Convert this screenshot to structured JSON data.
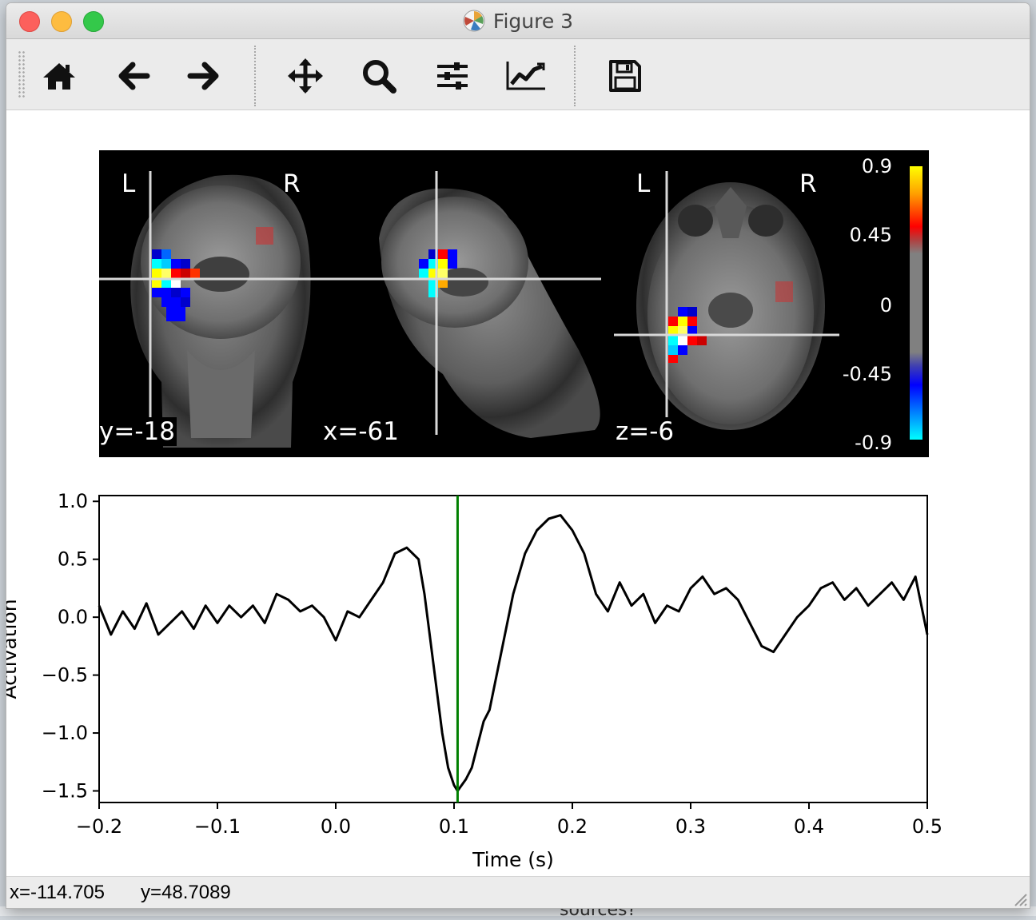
{
  "window": {
    "title": "Figure 3"
  },
  "toolbar": {
    "buttons": [
      {
        "name": "home",
        "icon": "home-icon"
      },
      {
        "name": "back",
        "icon": "arrow-left-icon"
      },
      {
        "name": "forward",
        "icon": "arrow-right-icon"
      },
      {
        "name": "pan",
        "icon": "move-icon"
      },
      {
        "name": "zoom",
        "icon": "magnifier-icon"
      },
      {
        "name": "configure-subplots",
        "icon": "sliders-icon"
      },
      {
        "name": "edit-axes",
        "icon": "line-chart-icon"
      },
      {
        "name": "save",
        "icon": "floppy-disk-icon"
      }
    ]
  },
  "brain": {
    "coronal": {
      "left": "L",
      "right": "R",
      "coord": "y=-18"
    },
    "sagittal": {
      "coord": "x=-61"
    },
    "axial": {
      "left": "L",
      "right": "R",
      "coord": "z=-6"
    },
    "colorbar": {
      "ticks": [
        "0.9",
        "0.45",
        "0",
        "-0.45",
        "-0.9"
      ],
      "colors": [
        "#ffff00",
        "#ff0000",
        "#808080",
        "#0000ff",
        "#00ffff"
      ]
    }
  },
  "chart_data": {
    "type": "line",
    "xlabel": "Time (s)",
    "ylabel": "Activation",
    "xlim": [
      -0.2,
      0.5
    ],
    "ylim": [
      -1.6,
      1.05
    ],
    "xticks": [
      "−0.2",
      "−0.1",
      "0.0",
      "0.1",
      "0.2",
      "0.3",
      "0.4",
      "0.5"
    ],
    "yticks": [
      "1.0",
      "0.5",
      "0.0",
      "−0.5",
      "−1.0",
      "−1.5"
    ],
    "xtick_values": [
      -0.2,
      -0.1,
      0.0,
      0.1,
      0.2,
      0.3,
      0.4,
      0.5
    ],
    "ytick_values": [
      1.0,
      0.5,
      0.0,
      -0.5,
      -1.0,
      -1.5
    ],
    "vline": {
      "x": 0.103,
      "color": "#008000"
    },
    "series": [
      {
        "color": "#000000",
        "x": [
          -0.2,
          -0.19,
          -0.18,
          -0.17,
          -0.16,
          -0.15,
          -0.14,
          -0.13,
          -0.12,
          -0.11,
          -0.1,
          -0.09,
          -0.08,
          -0.07,
          -0.06,
          -0.05,
          -0.04,
          -0.03,
          -0.02,
          -0.01,
          0.0,
          0.01,
          0.02,
          0.03,
          0.04,
          0.05,
          0.06,
          0.07,
          0.075,
          0.08,
          0.085,
          0.09,
          0.095,
          0.1,
          0.103,
          0.11,
          0.115,
          0.12,
          0.125,
          0.13,
          0.14,
          0.15,
          0.16,
          0.17,
          0.18,
          0.19,
          0.2,
          0.21,
          0.22,
          0.23,
          0.24,
          0.25,
          0.26,
          0.27,
          0.28,
          0.29,
          0.3,
          0.31,
          0.32,
          0.33,
          0.34,
          0.35,
          0.36,
          0.37,
          0.38,
          0.39,
          0.4,
          0.41,
          0.42,
          0.43,
          0.44,
          0.45,
          0.46,
          0.47,
          0.48,
          0.49,
          0.5
        ],
        "y": [
          0.1,
          -0.15,
          0.05,
          -0.1,
          0.12,
          -0.15,
          -0.05,
          0.05,
          -0.1,
          0.1,
          -0.05,
          0.1,
          0.0,
          0.1,
          -0.05,
          0.2,
          0.15,
          0.05,
          0.1,
          0.0,
          -0.2,
          0.05,
          0.0,
          0.15,
          0.3,
          0.55,
          0.6,
          0.5,
          0.2,
          -0.2,
          -0.6,
          -1.0,
          -1.3,
          -1.45,
          -1.5,
          -1.4,
          -1.3,
          -1.1,
          -0.9,
          -0.8,
          -0.3,
          0.2,
          0.55,
          0.75,
          0.85,
          0.88,
          0.75,
          0.55,
          0.2,
          0.05,
          0.3,
          0.1,
          0.2,
          -0.05,
          0.1,
          0.05,
          0.25,
          0.35,
          0.2,
          0.25,
          0.15,
          -0.05,
          -0.25,
          -0.3,
          -0.15,
          0.0,
          0.1,
          0.25,
          0.3,
          0.15,
          0.25,
          0.1,
          0.2,
          0.3,
          0.15,
          0.35,
          -0.15
        ]
      }
    ]
  },
  "statusbar": {
    "x": "x=-114.705",
    "y": "y=48.7089"
  },
  "background": {
    "text": "sources?"
  }
}
